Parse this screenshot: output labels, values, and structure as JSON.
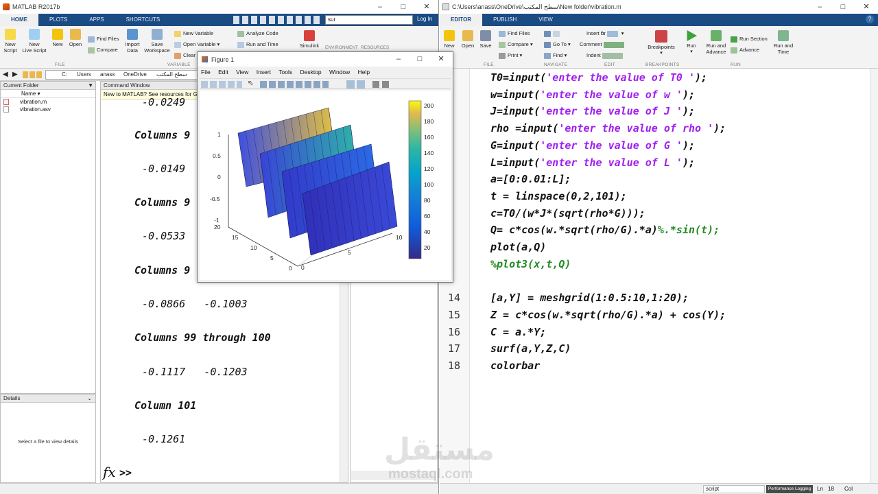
{
  "left_window": {
    "title": "MATLAB R2017b",
    "tabs": [
      "HOME",
      "PLOTS",
      "APPS",
      "SHORTCUTS"
    ],
    "search_value": "sur",
    "login_label": "Log In",
    "toolstrip": {
      "new_script": "New\nScript",
      "new_live_script": "New\nLive Script",
      "new": "New",
      "open": "Open",
      "find_files": "Find Files",
      "compare": "Compare",
      "import_data": "Import\nData",
      "save_workspace": "Save\nWorkspace",
      "new_variable": "New Variable",
      "open_variable": "Open Variable",
      "clear": "Clear",
      "analyze_code": "Analyze Code",
      "run_and_time": "Run and Time",
      "simulink": "Simulink",
      "environment": "ENVIRONMENT",
      "resources": "RESOURCES",
      "group_file": "FILE",
      "group_variable": "VARIABLE"
    },
    "path": [
      "C:",
      "Users",
      "anass",
      "OneDrive",
      "سطح المكتب"
    ],
    "current_folder": {
      "title": "Current Folder",
      "name_header": "Name",
      "files": [
        "vibration.m",
        "vibration.asv"
      ]
    },
    "details": {
      "title": "Details",
      "hint": "Select a file to view details"
    },
    "command_window": {
      "title": "Command Window",
      "banner": "New to MATLAB? See resources for Get",
      "lines": [
        "-0.0249",
        "Columns 9",
        "-0.0149",
        "Columns 9",
        "-0.0533",
        "Columns 9",
        "-0.0866   -0.1003",
        "Columns 99 through 100",
        "-0.1117   -0.1203",
        "Column 101",
        "-0.1261"
      ],
      "prompt": ">>"
    }
  },
  "figure": {
    "title": "Figure 1",
    "menu": [
      "File",
      "Edit",
      "View",
      "Insert",
      "Tools",
      "Desktop",
      "Window",
      "Help"
    ],
    "colorbar_ticks": [
      "200",
      "180",
      "160",
      "140",
      "120",
      "100",
      "80",
      "60",
      "40",
      "20"
    ],
    "z_ticks": [
      "1",
      "0.5",
      "0",
      "-0.5",
      "-1"
    ],
    "y_ticks": [
      "20",
      "15",
      "10",
      "5",
      "0"
    ],
    "x_ticks": [
      "0",
      "5",
      "10"
    ]
  },
  "editor": {
    "title": "C:\\Users\\anass\\OneDrive\\سطح المكتب\\New folder\\vibration.m",
    "tabs": [
      "EDITOR",
      "PUBLISH",
      "VIEW"
    ],
    "toolstrip": {
      "new": "New",
      "open": "Open",
      "save": "Save",
      "find_files": "Find Files",
      "compare": "Compare",
      "print": "Print",
      "go_to": "Go To",
      "find": "Find",
      "insert": "Insert",
      "comment": "Comment",
      "indent": "Indent",
      "breakpoints": "Breakpoints",
      "run": "Run",
      "run_and_advance": "Run and\nAdvance",
      "run_section": "Run Section",
      "advance": "Advance",
      "run_and_time": "Run and\nTime",
      "group_file": "FILE",
      "group_navigate": "NAVIGATE",
      "group_edit": "EDIT",
      "group_breakpoints": "BREAKPOINTS",
      "group_run": "RUN"
    },
    "code": [
      {
        "num": "",
        "text": "T0=input(",
        "str": "'enter the value of T0 '",
        "tail": ");"
      },
      {
        "num": "",
        "text": "w=input(",
        "str": "'enter the value of w '",
        "tail": ");"
      },
      {
        "num": "",
        "text": "J=input(",
        "str": "'enter the value of J '",
        "tail": ");"
      },
      {
        "num": "",
        "text": "rho =input(",
        "str": "'enter the value of rho '",
        "tail": ");"
      },
      {
        "num": "",
        "text": "G=input(",
        "str": "'enter the value of G '",
        "tail": ");"
      },
      {
        "num": "",
        "text": "L=input(",
        "str": "'enter the value of L '",
        "tail": ");"
      },
      {
        "num": "",
        "text": "a=[0:0.01:L];",
        "str": "",
        "tail": ""
      },
      {
        "num": "",
        "text": "t = linspace(0,2,101);",
        "str": "",
        "tail": ""
      },
      {
        "num": "",
        "text": "c=T0/(w*J*(sqrt(rho*G)));",
        "str": "",
        "tail": ""
      },
      {
        "num": "",
        "text": "Q= c*cos(w.*sqrt(rho/G).*a)",
        "str": "",
        "tail": "",
        "cmt": "%.*sin(t);"
      },
      {
        "num": "",
        "text": "plot(a,Q)",
        "str": "",
        "tail": ""
      },
      {
        "num": "",
        "text": "",
        "str": "",
        "tail": "",
        "cmt": "%plot3(x,t,Q)"
      },
      {
        "num": "",
        "text": "",
        "str": "",
        "tail": ""
      },
      {
        "num": "14",
        "text": "[a,Y] = meshgrid(1:0.5:10,1:20);",
        "str": "",
        "tail": ""
      },
      {
        "num": "15",
        "text": "Z = c*cos(w.*sqrt(rho/G).*a) + cos(Y);",
        "str": "",
        "tail": ""
      },
      {
        "num": "16",
        "text": "C = a.*Y;",
        "str": "",
        "tail": ""
      },
      {
        "num": "17",
        "text": "surf(a,Y,Z,C)",
        "str": "",
        "tail": ""
      },
      {
        "num": "18",
        "text": "colorbar",
        "str": "",
        "tail": ""
      }
    ],
    "status": {
      "mode": "script",
      "perf": "Performance Logging",
      "ln_label": "Ln",
      "ln": "18",
      "col_label": "Col"
    }
  },
  "watermark": {
    "arabic": "مستقل",
    "latin": "mostaql.com"
  },
  "colors": {
    "ribbon_blue": "#1b4b83",
    "string_purple": "#a020f0",
    "comment_green": "#228b22"
  }
}
